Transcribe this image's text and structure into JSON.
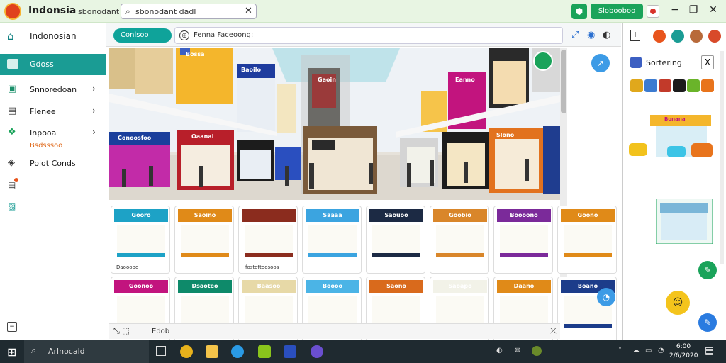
{
  "window": {
    "title": "Indonsia",
    "subtitle": "sbonodant",
    "search_text": "sbonodant dadl",
    "action_button": "Slobooboo",
    "minimize": "−",
    "restore": "❐",
    "close": "✕"
  },
  "sidebar": {
    "header": "Indonosian",
    "active_item": "Gdoss",
    "items": [
      {
        "label": "Snnoredoan",
        "chevron": "›"
      },
      {
        "label": "Flenee",
        "chevron": "›"
      },
      {
        "label": "Inpooa",
        "chevron": "›"
      },
      {
        "label": "Polot Conds",
        "chevron": ""
      }
    ],
    "sublabel": "Bsdsssoo"
  },
  "content": {
    "tab_label": "Conlsoo",
    "address_text": "Fenna     Faceoong:",
    "grid_captions": [
      "Daooobo",
      "fostottoosoos"
    ],
    "bottom_label": "Edob"
  },
  "scene": {
    "signs": [
      "Conoosfoo",
      "Oaanal",
      "Baoilo",
      "Eanno",
      "Slono",
      "Bossa",
      "Gaoin"
    ]
  },
  "cards": [
    {
      "sign": "Gooro",
      "color": "#1da2c6"
    },
    {
      "sign": "Saoino",
      "color": "#e08a18"
    },
    {
      "sign": "",
      "color": "#8b2c1e"
    },
    {
      "sign": "Saaaa",
      "color": "#3ba4e0"
    },
    {
      "sign": "Saouoo",
      "color": "#1c2a44"
    },
    {
      "sign": "Goobio",
      "color": "#d9862a"
    },
    {
      "sign": "Boooono",
      "color": "#7b2a9a"
    },
    {
      "sign": "Goono",
      "color": "#e08a18"
    },
    {
      "sign": "Goonoo",
      "color": "#c2147e"
    },
    {
      "sign": "Dsaoteo",
      "color": "#0e8a6a"
    },
    {
      "sign": "Baasoo",
      "color": "#e7d9a7"
    },
    {
      "sign": "Boooo",
      "color": "#4bb4e6"
    },
    {
      "sign": "Saono",
      "color": "#d96a1c"
    },
    {
      "sign": "Saoapo",
      "color": "#f2f2e8"
    },
    {
      "sign": "Daano",
      "color": "#e08a18"
    },
    {
      "sign": "Boano",
      "color": "#1c3c8a"
    }
  ],
  "right_panel": {
    "heading": "Sortering",
    "close": "X",
    "kiosk_sign": "Bonana"
  },
  "taskbar": {
    "search_text": "Arlnocald",
    "time": "6:00",
    "date": "2/6/2020"
  },
  "colors": {
    "accent": "#1a9c94",
    "titlebar": "#e8f5e3",
    "action": "#1aa35a"
  }
}
